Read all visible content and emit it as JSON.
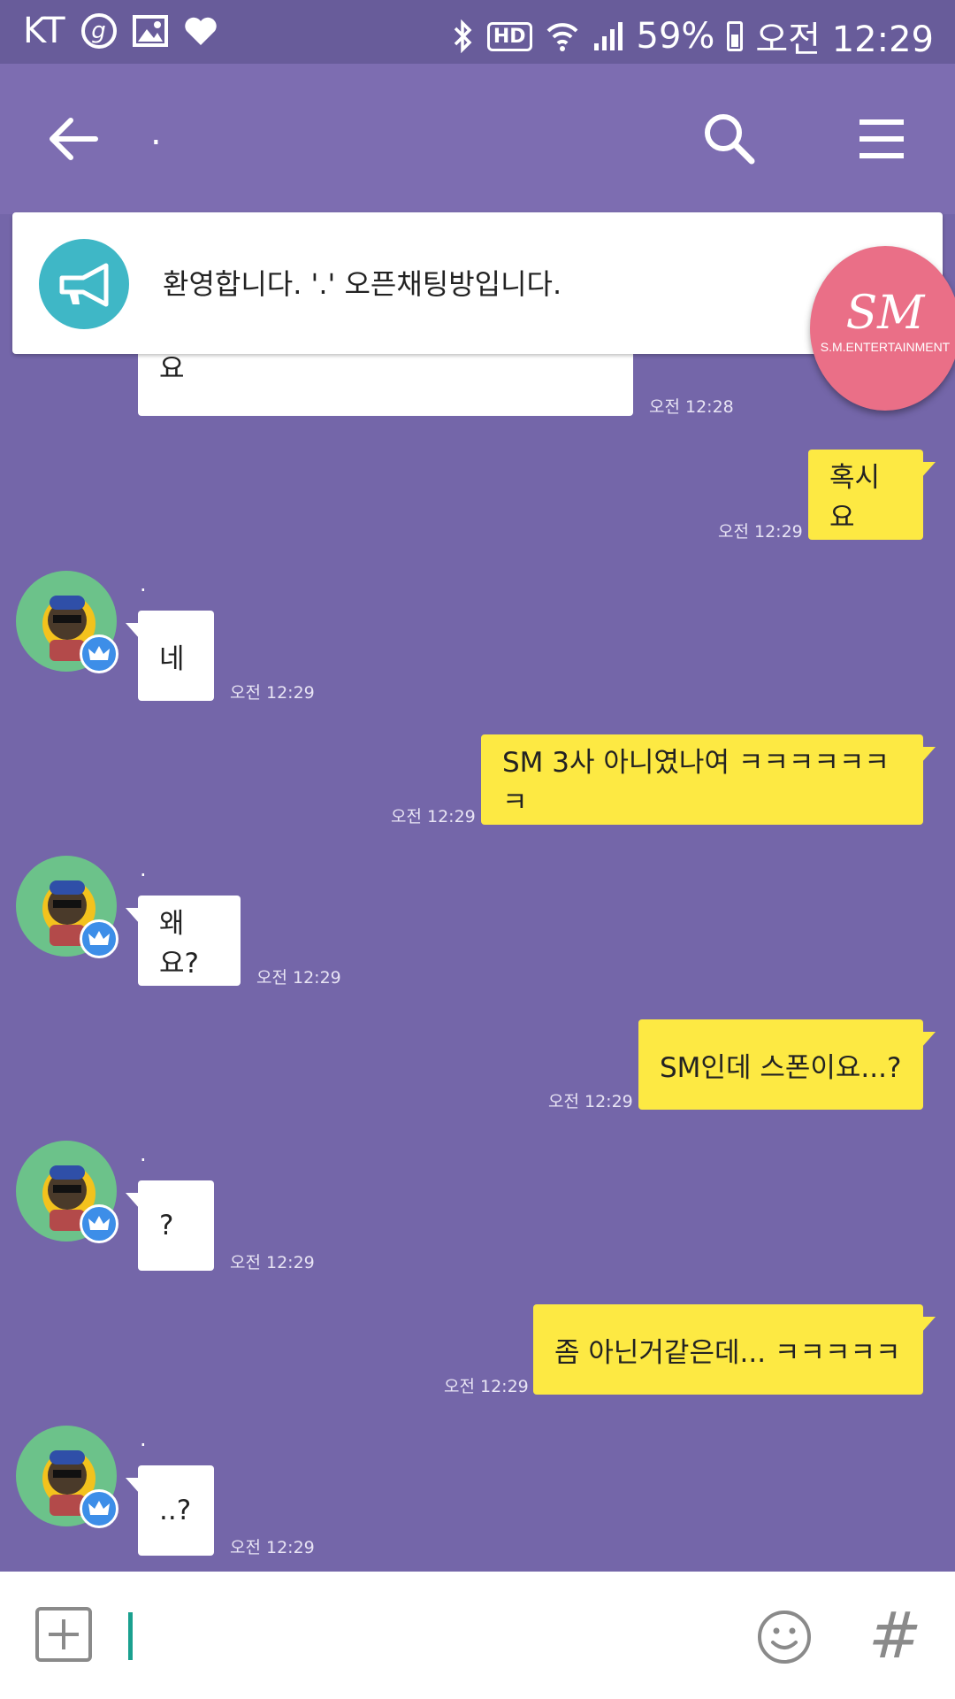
{
  "status_bar": {
    "carrier": "KT",
    "g_icon": "g",
    "battery": "59%",
    "time": "오전 12:29",
    "hd": "HD"
  },
  "header": {
    "title": "."
  },
  "notice": {
    "text": "환영합니다. '.' 오픈채팅방입니다."
  },
  "sm_badge": {
    "logo": "SM",
    "sub": "S.M.ENTERTAINMENT"
  },
  "messages": [
    {
      "side": "left",
      "text": "스폰한다면 처음인데 좀 그럴긴하겠네요",
      "time": "오전 12:28"
    },
    {
      "side": "right",
      "text": "혹시요",
      "time": "오전 12:29"
    },
    {
      "side": "left",
      "sender": ".",
      "text": "네",
      "time": "오전 12:29"
    },
    {
      "side": "right",
      "text": "SM 3사 아니였나여 ㅋㅋㅋㅋㅋㅋㅋ",
      "time": "오전 12:29"
    },
    {
      "side": "left",
      "sender": ".",
      "text": "왜요?",
      "time": "오전 12:29"
    },
    {
      "side": "right",
      "text": "SM인데 스폰이요...?",
      "time": "오전 12:29"
    },
    {
      "side": "left",
      "sender": ".",
      "text": "?",
      "time": "오전 12:29"
    },
    {
      "side": "right",
      "text": "좀 아닌거같은데... ㅋㅋㅋㅋㅋ",
      "time": "오전 12:29"
    },
    {
      "side": "left",
      "sender": ".",
      "text": "..?",
      "time": "오전 12:29"
    }
  ],
  "input": {
    "hash": "#"
  },
  "colors": {
    "chat_bg": "#7466a9",
    "header_bg": "#7d6db1",
    "my_bubble": "#fde943",
    "their_bubble": "#ffffff",
    "accent": "#3fb7c6"
  }
}
